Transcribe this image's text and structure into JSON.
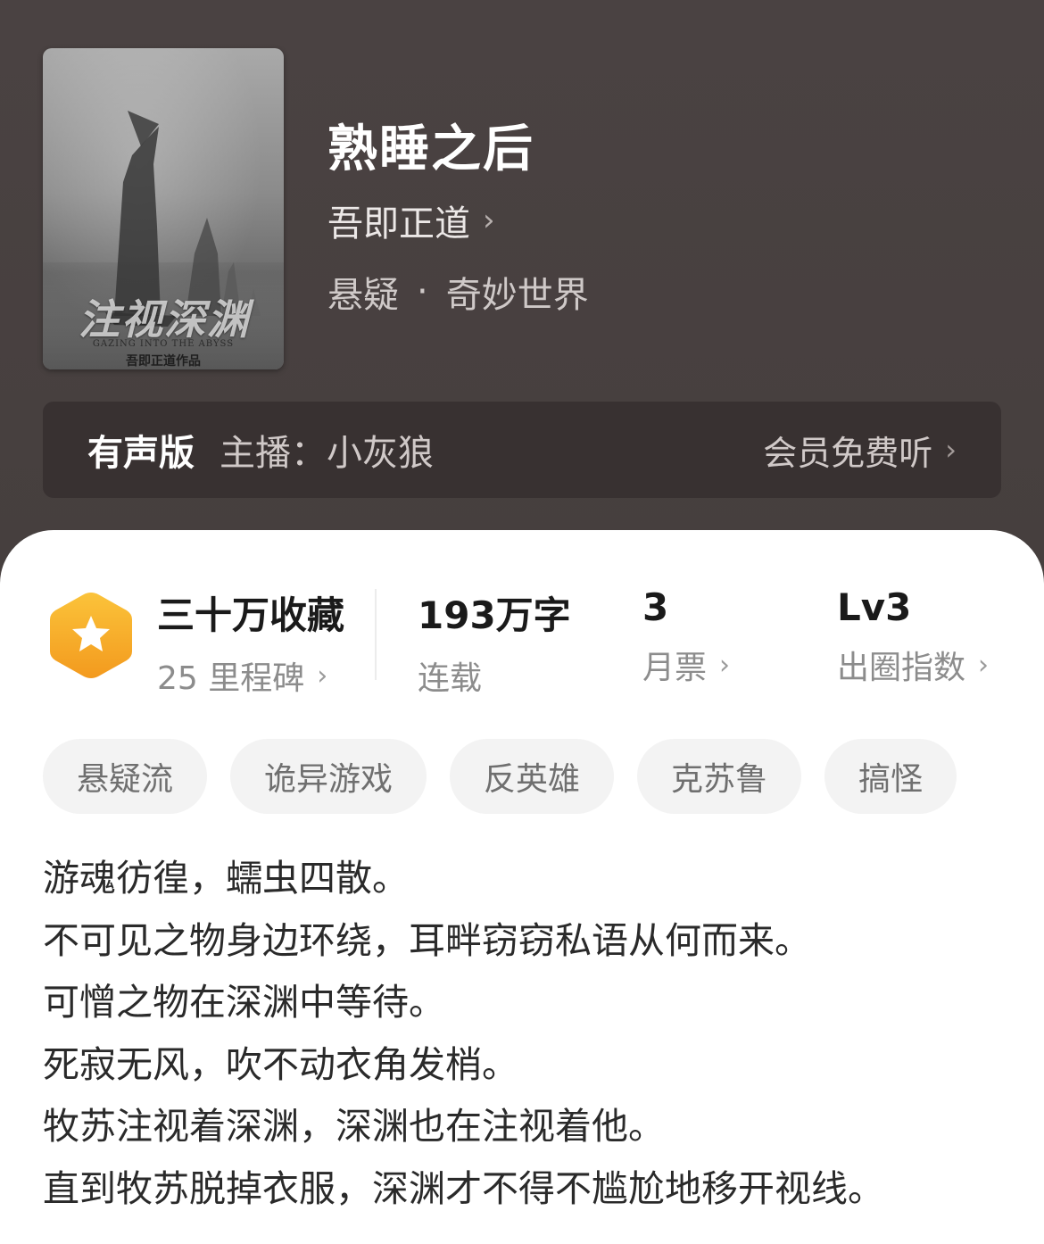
{
  "book": {
    "title": "熟睡之后",
    "author": "吾即正道",
    "genre_primary": "悬疑",
    "genre_separator": "·",
    "genre_secondary": "奇妙世界",
    "cover": {
      "title": "注视深渊",
      "subtitle": "GAZING INTO THE ABYSS",
      "author_line": "吾即正道作品"
    }
  },
  "audio": {
    "label": "有声版",
    "host": "主播：小灰狼",
    "cta": "会员免费听"
  },
  "stats": {
    "collections_title": "三十万收藏",
    "collections_sub": "25 里程碑",
    "words_title": "193万字",
    "words_sub": "连载",
    "monthly_title": "3",
    "monthly_sub": "月票",
    "breakout_title": "Lv3",
    "breakout_sub": "出圈指数"
  },
  "tags": [
    "悬疑流",
    "诡异游戏",
    "反英雄",
    "克苏鲁",
    "搞怪"
  ],
  "synopsis": [
    "游魂彷徨，蠕虫四散。",
    "不可见之物身边环绕，耳畔窃窃私语从何而来。",
    "可憎之物在深渊中等待。",
    "死寂无风，吹不动衣角发梢。",
    "牧苏注视着深渊，深渊也在注视着他。",
    "直到牧苏脱掉衣服，深渊才不得不尴尬地移开视线。"
  ],
  "colors": {
    "header_bg": "#4a4242",
    "audio_bar_bg": "#383131",
    "badge_orange": "#f7a928",
    "tag_bg": "#f3f3f3"
  },
  "icons": {
    "chevron": "chevron-right-icon",
    "badge": "star-hexagon-icon"
  }
}
